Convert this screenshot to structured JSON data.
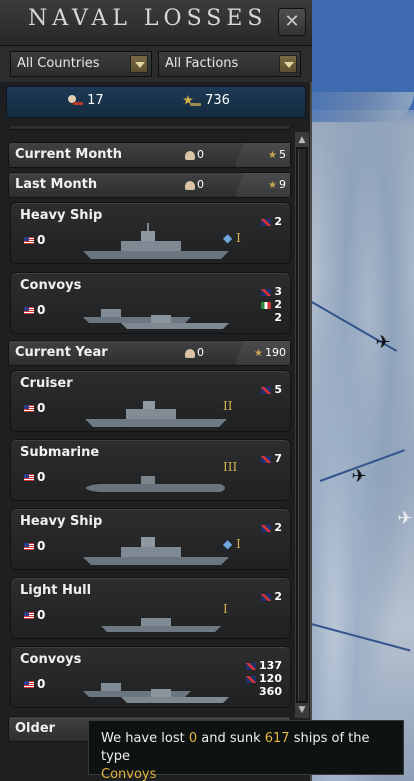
{
  "window": {
    "title": "Naval Losses",
    "close_glyph": "✕"
  },
  "filters": {
    "country": "All Countries",
    "faction": "All Factions"
  },
  "totals": {
    "lost": "17",
    "sunk": "736"
  },
  "groups": [
    {
      "label": "Current Month",
      "lost": "0",
      "sunk": "5"
    },
    {
      "label": "Last Month",
      "lost": "0",
      "sunk": "9"
    },
    {
      "label": "Current Year",
      "lost": "0",
      "sunk": "190"
    }
  ],
  "cards": [
    {
      "name": "Heavy Ship",
      "lost": "0",
      "rank": "I",
      "sunk": [
        {
          "flag": "uk",
          "value": "2"
        }
      ]
    },
    {
      "name": "Convoys",
      "lost": "0",
      "rank": "",
      "sunk": [
        {
          "flag": "uk",
          "value": "3"
        },
        {
          "flag": "it",
          "value": "2"
        },
        {
          "flag": "",
          "value": "2"
        }
      ]
    },
    {
      "name": "Cruiser",
      "lost": "0",
      "rank": "II",
      "sunk": [
        {
          "flag": "uk",
          "value": "5"
        }
      ]
    },
    {
      "name": "Submarine",
      "lost": "0",
      "rank": "III",
      "sunk": [
        {
          "flag": "uk",
          "value": "7"
        }
      ]
    },
    {
      "name": "Heavy Ship",
      "lost": "0",
      "rank": "I",
      "sunk": [
        {
          "flag": "uk",
          "value": "2"
        }
      ]
    },
    {
      "name": "Light Hull",
      "lost": "0",
      "rank": "I",
      "sunk": [
        {
          "flag": "uk",
          "value": "2"
        }
      ]
    },
    {
      "name": "Convoys",
      "lost": "0",
      "rank": "",
      "sunk": [
        {
          "flag": "uk",
          "value": "137"
        },
        {
          "flag": "uk",
          "value": "120"
        },
        {
          "flag": "",
          "value": "360"
        }
      ]
    }
  ],
  "older": {
    "label": "Older"
  },
  "tooltip": {
    "prefix": "We have lost ",
    "lost": "0",
    "middle": " and sunk ",
    "sunk": "617",
    "suffix": " ships of the type",
    "type": "Convoys"
  },
  "icons": {
    "lost": "skull-ship-icon",
    "sunk": "star-ship-icon",
    "close": "close-icon",
    "plane": "plane-icon"
  },
  "colors": {
    "accent": "#e3b53f",
    "rank": "#d4b24a",
    "totals_bg": "#1d3a55"
  }
}
